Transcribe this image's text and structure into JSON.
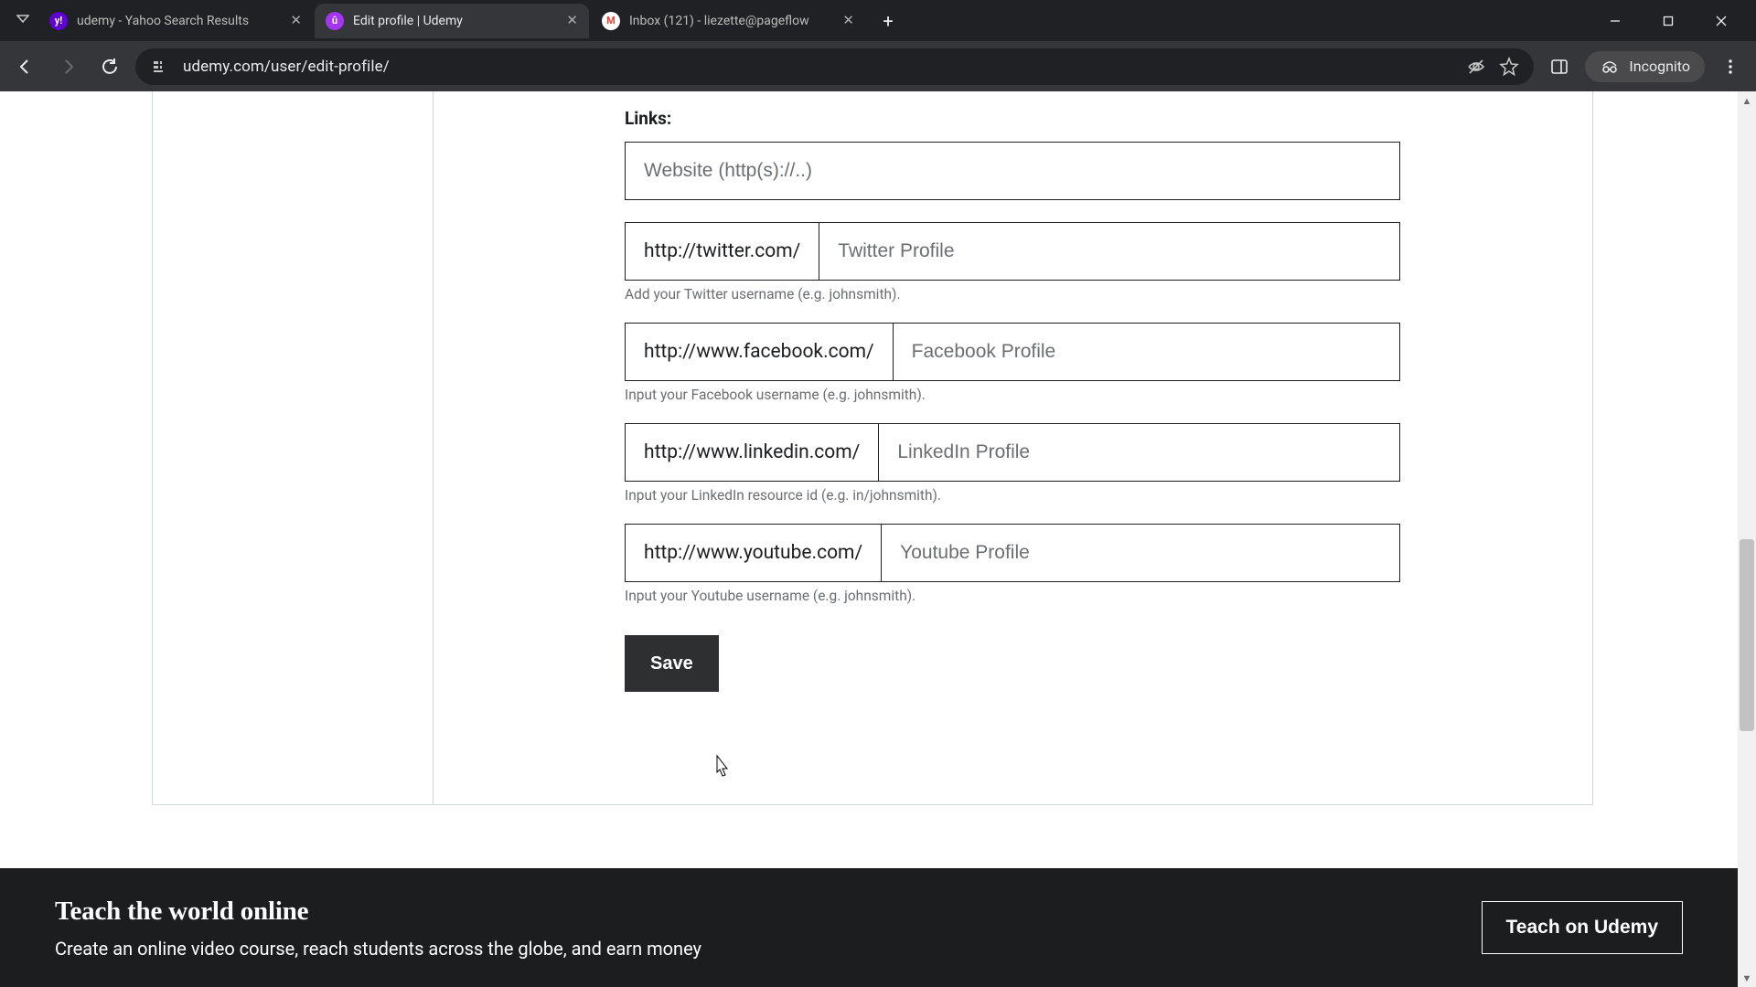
{
  "browser": {
    "tabs": [
      {
        "title": "udemy - Yahoo Search Results",
        "favicon": "Y",
        "active": false
      },
      {
        "title": "Edit profile | Udemy",
        "favicon": "U",
        "active": true
      },
      {
        "title": "Inbox (121) - liezette@pageflow",
        "favicon": "M",
        "active": false
      }
    ],
    "url": "udemy.com/user/edit-profile/",
    "incognito_label": "Incognito"
  },
  "form": {
    "section_label": "Links:",
    "website": {
      "placeholder": "Website (http(s)://..)"
    },
    "twitter": {
      "prefix": "http://twitter.com/",
      "placeholder": "Twitter Profile",
      "helper": "Add your Twitter username (e.g. johnsmith)."
    },
    "facebook": {
      "prefix": "http://www.facebook.com/",
      "placeholder": "Facebook Profile",
      "helper": "Input your Facebook username (e.g. johnsmith)."
    },
    "linkedin": {
      "prefix": "http://www.linkedin.com/",
      "placeholder": "LinkedIn Profile",
      "helper": "Input your LinkedIn resource id (e.g. in/johnsmith)."
    },
    "youtube": {
      "prefix": "http://www.youtube.com/",
      "placeholder": "Youtube Profile",
      "helper": "Input your Youtube username (e.g. johnsmith)."
    },
    "save_label": "Save"
  },
  "banner": {
    "heading": "Teach the world online",
    "sub": "Create an online video course, reach students across the globe, and earn money",
    "cta": "Teach on Udemy"
  }
}
